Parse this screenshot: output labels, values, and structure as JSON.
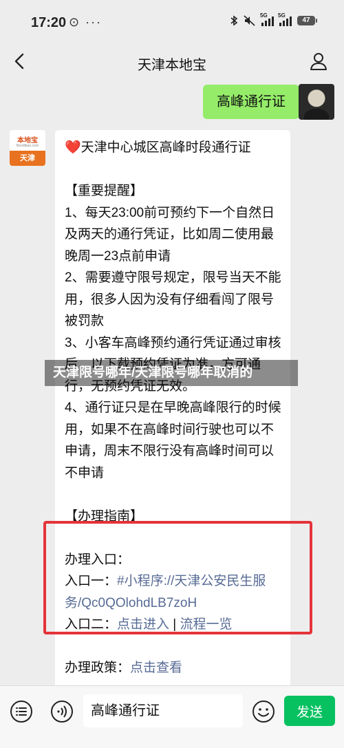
{
  "status_bar": {
    "time": "17:20",
    "extra": "⊙ ···",
    "sig1_label": "5G",
    "sig2_label": "5G",
    "battery": "47"
  },
  "header": {
    "title": "天津本地宝",
    "back_icon": "chevron-left-icon",
    "profile_icon": "person-icon"
  },
  "chat": {
    "user_message": "高峰通行证",
    "bot_avatar": {
      "logo_text": "本地宝",
      "logo_sub": "Bendibao.com",
      "city": "天津"
    },
    "bot_message": {
      "heart": "❤️",
      "title": "天津中心城区高峰时段通行证",
      "reminder_header": "【重要提醒】",
      "items": [
        "1、每天23:00前可预约下一个自然日及两天的通行凭证，比如周二使用最晚周一23点前申请",
        "2、需要遵守限号规定，限号当天不能用，很多人因为没有仔细看闯了限号被罚款",
        "3、小客车高峰预约通行凭证通过审核后，以下载预约凭证为准，方可通行，无预约凭证无效。",
        "4、通行证只是在早晚高峰限行的时候用，如果不在高峰时间行驶也可以不申请，周末不限行没有高峰时间可以不申请"
      ],
      "guide_header": "【办理指南】",
      "entry_label": "办理入口：",
      "entry1_prefix": "入口一：",
      "entry1_link": "#小程序://天津公安民生服务/Qc0QOlohdLB7zoH",
      "entry2_prefix": "入口二：",
      "entry2_link1": "点击进入",
      "entry2_sep": " | ",
      "entry2_link2": "流程一览",
      "policy_prefix": "办理政策：",
      "policy_link": "点击查看"
    }
  },
  "watermark": "天津限号哪年/天津限号哪年取消的",
  "input_bar": {
    "value": "高峰通行证",
    "send_label": "发送",
    "colors": {
      "send": "#07c160",
      "bubble_user": "#95ec69",
      "link": "#576b95",
      "highlight_box": "#e5333a"
    }
  }
}
